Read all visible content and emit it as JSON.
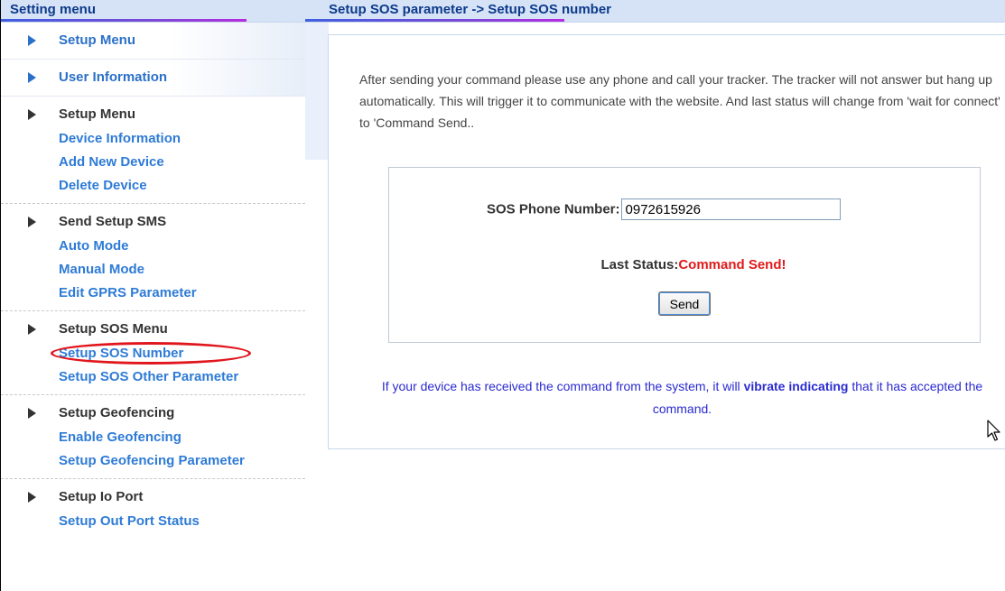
{
  "sidebar": {
    "title": "Setting menu",
    "top_items": [
      {
        "label": "Setup Menu"
      },
      {
        "label": "User Information"
      }
    ],
    "groups": [
      {
        "title": "Setup Menu",
        "links": [
          "Device Information",
          "Add New Device",
          "Delete Device"
        ]
      },
      {
        "title": "Send Setup SMS",
        "links": [
          "Auto Mode",
          "Manual Mode",
          "Edit GPRS Parameter"
        ]
      },
      {
        "title": "Setup SOS Menu",
        "links": [
          "Setup SOS Number",
          "Setup SOS Other Parameter"
        ]
      },
      {
        "title": "Setup Geofencing",
        "links": [
          "Enable Geofencing",
          "Setup Geofencing Parameter"
        ]
      },
      {
        "title": "Setup Io Port",
        "links": [
          "Setup Out Port Status"
        ]
      }
    ]
  },
  "main": {
    "title": "Setup SOS parameter -> Setup SOS number",
    "intro": "After sending your command please use any phone and call your tracker. The tracker will not answer but hang up automatically. This will trigger it to communicate with the website. And last status will change from 'wait for connect' to 'Command Send..",
    "form": {
      "phone_label": "SOS Phone Number:",
      "phone_value": "0972615926",
      "status_label": "Last Status:",
      "status_value": "Command Send!",
      "send_label": "Send"
    },
    "note": {
      "before": "If your device has received the command from the system, it will ",
      "bold": "vibrate indicating",
      "after": " that it has accepted the command."
    }
  },
  "colors": {
    "header_bg": "#d6e3f7",
    "link": "#2e7bd6",
    "status_red": "#e01b1b",
    "note_blue": "#2a2ad0",
    "highlight": "#e0161c"
  }
}
